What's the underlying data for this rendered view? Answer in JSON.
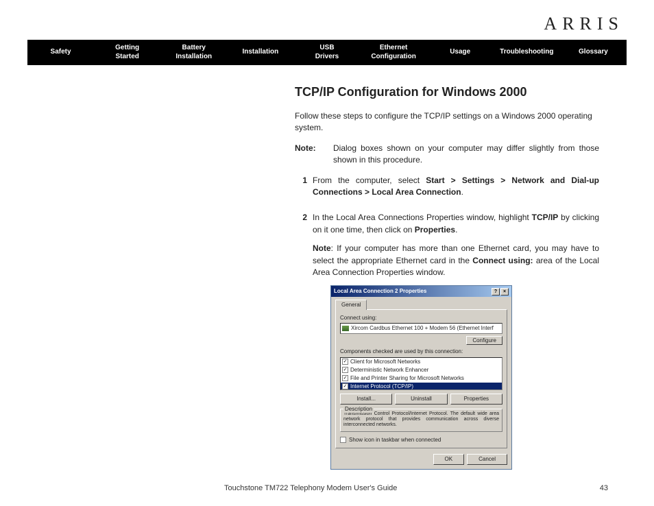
{
  "logo": "ARRIS",
  "nav": [
    "Safety",
    "Getting\nStarted",
    "Battery\nInstallation",
    "Installation",
    "USB\nDrivers",
    "Ethernet\nConfiguration",
    "Usage",
    "Troubleshooting",
    "Glossary"
  ],
  "heading": "TCP/IP Configuration for Windows 2000",
  "intro": "Follow these steps to configure the TCP/IP settings on a Windows 2000 operating system.",
  "note_label": "Note:",
  "note_text": "Dialog boxes shown on your computer may differ slightly from those shown in this procedure.",
  "steps": {
    "s1_num": "1",
    "s1_a": "From the computer, select ",
    "s1_b": "Start > Settings > Network and Dial-up Connections > Local Area Connection",
    "s1_c": ".",
    "s2_num": "2",
    "s2_a": "In the Local Area Connections Properties window, highlight ",
    "s2_b": "TCP/IP",
    "s2_c": " by clicking on it one time, then click on ",
    "s2_d": "Properties",
    "s2_e": ".",
    "s2_note_a": "Note",
    "s2_note_b": ": If your computer has more than one Ethernet card, you may have to select the appropriate Ethernet card in the ",
    "s2_note_c": "Connect using:",
    "s2_note_d": " area of the Local Area Connection Properties window."
  },
  "dialog": {
    "title": "Local Area Connection 2 Properties",
    "help": "?",
    "close": "×",
    "tab": "General",
    "connect_label": "Connect using:",
    "adapter": "Xircom Cardbus Ethernet 100 + Modem 56 (Ethernet Interf",
    "configure": "Configure",
    "components_label": "Components checked are used by this connection:",
    "items": [
      "Client for Microsoft Networks",
      "Deterministic Network Enhancer",
      "File and Printer Sharing for Microsoft Networks",
      "Internet Protocol (TCP/IP)"
    ],
    "install": "Install...",
    "uninstall": "Uninstall",
    "properties": "Properties",
    "desc_legend": "Description",
    "desc": "Transmission Control Protocol/Internet Protocol. The default wide area network protocol that provides communication across diverse interconnected networks.",
    "show_icon": "Show icon in taskbar when connected",
    "ok": "OK",
    "cancel": "Cancel"
  },
  "footer": {
    "title": "Touchstone TM722 Telephony Modem User's Guide",
    "page": "43"
  }
}
